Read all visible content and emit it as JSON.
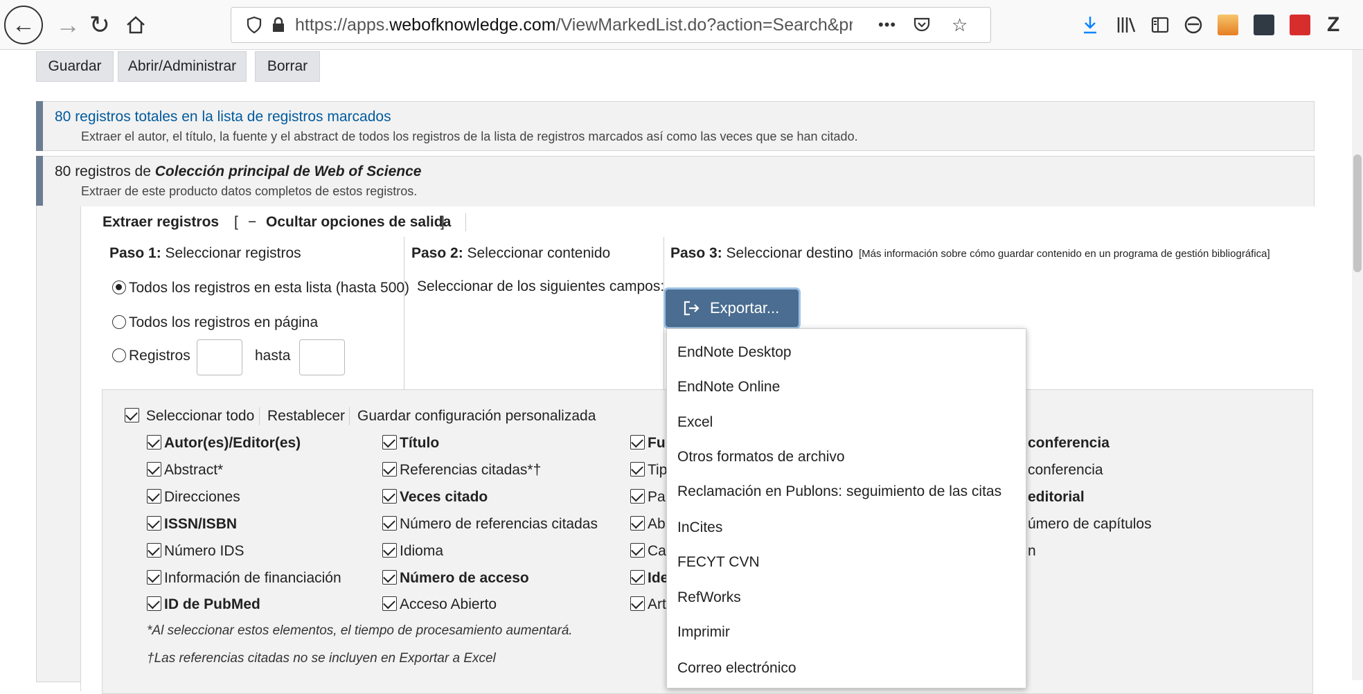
{
  "browser": {
    "url_prefix": "https://apps.",
    "url_domain": "webofknowledge.com",
    "url_path": "/ViewMarkedList.do?action=Search&product=WOS&SID",
    "more_label": "•••",
    "icons": [
      "back-icon",
      "forward-icon",
      "reload-icon",
      "home-icon",
      "shield-icon",
      "lock-icon",
      "more-icon",
      "pocket-icon",
      "star-icon",
      "download-icon",
      "library-icon",
      "sidebar-icon",
      "account-icon",
      "rss-icon",
      "extension-icon",
      "mendeley-icon",
      "zotero-icon"
    ]
  },
  "actions": {
    "save": "Guardar",
    "open": "Abrir/Administrar",
    "clear": "Borrar"
  },
  "summary": {
    "title": "80 registros totales en la lista de registros marcados",
    "desc": "Extraer el autor, el título, la fuente y el abstract de todos los registros de la lista de registros marcados así como las veces que se han citado."
  },
  "wos": {
    "title_prefix": "80 registros de ",
    "title_italic": "Colección principal de Web of Science",
    "desc": "Extraer de este producto datos completos de estos registros."
  },
  "extract": {
    "label": "Extraer registros",
    "bracket_open": "[",
    "minus": "−",
    "hide_link": "Ocultar opciones de salida",
    "bracket_close": "]"
  },
  "step1": {
    "label": "Paso 1:",
    "text": " Seleccionar registros",
    "opt_all_list": "Todos los registros en esta lista (hasta 500)",
    "opt_all_page": "Todos los registros en página",
    "opt_records": "Registros",
    "until": "hasta"
  },
  "step2": {
    "label": "Paso 2:",
    "text": " Seleccionar contenido",
    "fields_label": "Seleccionar de los siguientes campos:"
  },
  "step3": {
    "label": "Paso 3:",
    "text": " Seleccionar destino",
    "more_info": "[Más información sobre cómo guardar contenido en un programa de gestión bibliográfica]",
    "export": "Exportar..."
  },
  "fields_toolbar": {
    "select_all": "Seleccionar todo",
    "reset": "Restablecer",
    "save_config": "Guardar configuración personalizada"
  },
  "fields": {
    "col1": [
      "Autor(es)/Editor(es)",
      "Abstract*",
      "Direcciones",
      "ISSN/ISBN",
      "Número IDS",
      "Información de financiación",
      "ID de PubMed"
    ],
    "col2": [
      "Título",
      "Referencias citadas*†",
      "Veces citado",
      "Número de referencias citadas",
      "Idioma",
      "Número de acceso",
      "Acceso Abierto"
    ],
    "col3": [
      "Fu",
      "Tip",
      "Pal",
      "Ab",
      "Cat",
      "Ide",
      "Art"
    ],
    "col4": [
      "conferencia",
      "conferencia",
      "editorial",
      "úmero de capítulos",
      "n"
    ]
  },
  "notes": {
    "n1": "*Al seleccionar estos elementos, el tiempo de procesamiento aumentará.",
    "n2": "†Las referencias citadas no se incluyen en Exportar a Excel"
  },
  "export_menu": [
    "EndNote Desktop",
    "EndNote Online",
    "Excel",
    "Otros formatos de archivo",
    "Reclamación en Publons: seguimiento de las citas",
    "InCites",
    "FECYT CVN",
    "RefWorks",
    "Imprimir",
    "Correo electrónico"
  ],
  "colors": {
    "accent": "#6b7d92",
    "link": "#005a9c",
    "export_button": "#4a6d91",
    "download": "#0a84ff"
  }
}
